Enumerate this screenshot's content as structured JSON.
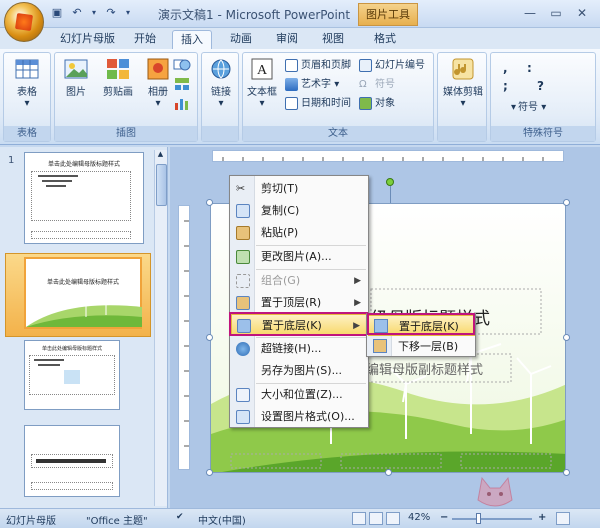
{
  "window": {
    "title": "演示文稿1 - Microsoft PowerPoint",
    "contextual_tab_group": "图片工具",
    "controls": [
      "—",
      "▭",
      "✕"
    ]
  },
  "quick_access": {
    "save_icon": "save-icon",
    "undo_icon": "undo-icon",
    "redo_icon": "redo-icon"
  },
  "tabs": [
    {
      "label": "幻灯片母版",
      "active": false
    },
    {
      "label": "开始",
      "active": false
    },
    {
      "label": "插入",
      "active": true
    },
    {
      "label": "动画",
      "active": false
    },
    {
      "label": "审阅",
      "active": false
    },
    {
      "label": "视图",
      "active": false
    },
    {
      "label": "格式",
      "active": false
    }
  ],
  "ribbon": {
    "groups": {
      "tables": {
        "label": "表格",
        "buttons": [
          "表格"
        ]
      },
      "illustrations": {
        "label": "插图",
        "buttons": [
          "图片",
          "剪贴画",
          "相册"
        ]
      },
      "links": {
        "label": "",
        "buttons": [
          "链接"
        ]
      },
      "text": {
        "label": "文本",
        "big": "文本框",
        "small": [
          "页眉和页脚",
          "艺术字",
          "日期和时间",
          "幻灯片编号",
          "符号",
          "对象"
        ]
      },
      "media": {
        "label": "",
        "buttons": [
          "媒体剪辑"
        ]
      },
      "symbols": {
        "label": "特殊符号",
        "chars": [
          ",",
          ":",
          ";",
          "?"
        ],
        "button": "符号"
      }
    }
  },
  "thumbnails": [
    {
      "number": "1",
      "title": "单击此处编辑母版标题样式",
      "selected": false
    },
    {
      "number": "",
      "title": "单击此处编辑母版标题样式",
      "selected": true
    },
    {
      "number": "",
      "title": "单击此处编辑母版标题样式",
      "selected": false
    },
    {
      "number": "",
      "title": "",
      "selected": false
    }
  ],
  "slide": {
    "title_text": "级母版标题样式",
    "subtitle_text": "编辑母版副标题样式"
  },
  "context_menu": {
    "items": [
      {
        "label": "剪切(T)",
        "icon": "scissors-icon",
        "disabled": false
      },
      {
        "label": "复制(C)",
        "icon": "copy-icon",
        "disabled": false
      },
      {
        "label": "粘贴(P)",
        "icon": "paste-icon",
        "disabled": false
      },
      {
        "label": "更改图片(A)...",
        "icon": "change-picture-icon",
        "disabled": false
      },
      {
        "label": "组合(G)",
        "icon": "group-icon",
        "disabled": true
      },
      {
        "label": "置于顶层(R)",
        "icon": "bring-to-front-icon",
        "disabled": false
      },
      {
        "label": "置于底层(K)",
        "icon": "send-to-back-icon",
        "disabled": false,
        "highlighted": true
      },
      {
        "label": "超链接(H)...",
        "icon": "hyperlink-icon",
        "disabled": false
      },
      {
        "label": "另存为图片(S)...",
        "icon": "",
        "disabled": false
      },
      {
        "label": "大小和位置(Z)...",
        "icon": "size-position-icon",
        "disabled": false
      },
      {
        "label": "设置图片格式(O)...",
        "icon": "format-picture-icon",
        "disabled": false
      }
    ],
    "submenu": [
      {
        "label": "置于底层(K)",
        "highlighted": true
      },
      {
        "label": "下移一层(B)",
        "highlighted": false
      }
    ]
  },
  "statusbar": {
    "view": "幻灯片母版",
    "theme": "\"Office 主题\"",
    "language": "中文(中国)",
    "zoom": "42%",
    "zoom_out": "−",
    "zoom_in": "+"
  },
  "colors": {
    "ribbon_bg": "#dfeaf7",
    "highlight": "#f8d86a",
    "annotation_box": "#c0147c",
    "contextual_tab": "#e7b04f"
  }
}
